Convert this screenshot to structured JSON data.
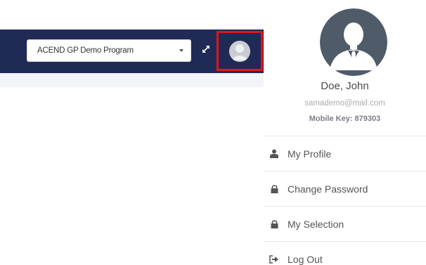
{
  "header": {
    "program_select": {
      "selected": "ACEND GP Demo Program"
    }
  },
  "user": {
    "name": "Doe, John",
    "email": "samademo@mail.com",
    "mobile_key": "Mobile Key: 879303"
  },
  "menu": {
    "items": [
      {
        "label": "My Profile",
        "icon": "user-icon"
      },
      {
        "label": "Change Password",
        "icon": "lock-icon"
      },
      {
        "label": "My Selection",
        "icon": "lock-icon"
      },
      {
        "label": "Log Out",
        "icon": "sign-out-icon"
      }
    ]
  },
  "colors": {
    "navbar": "#1f2a57",
    "highlight": "#e0161b",
    "avatar_bg": "#4f5b69"
  }
}
